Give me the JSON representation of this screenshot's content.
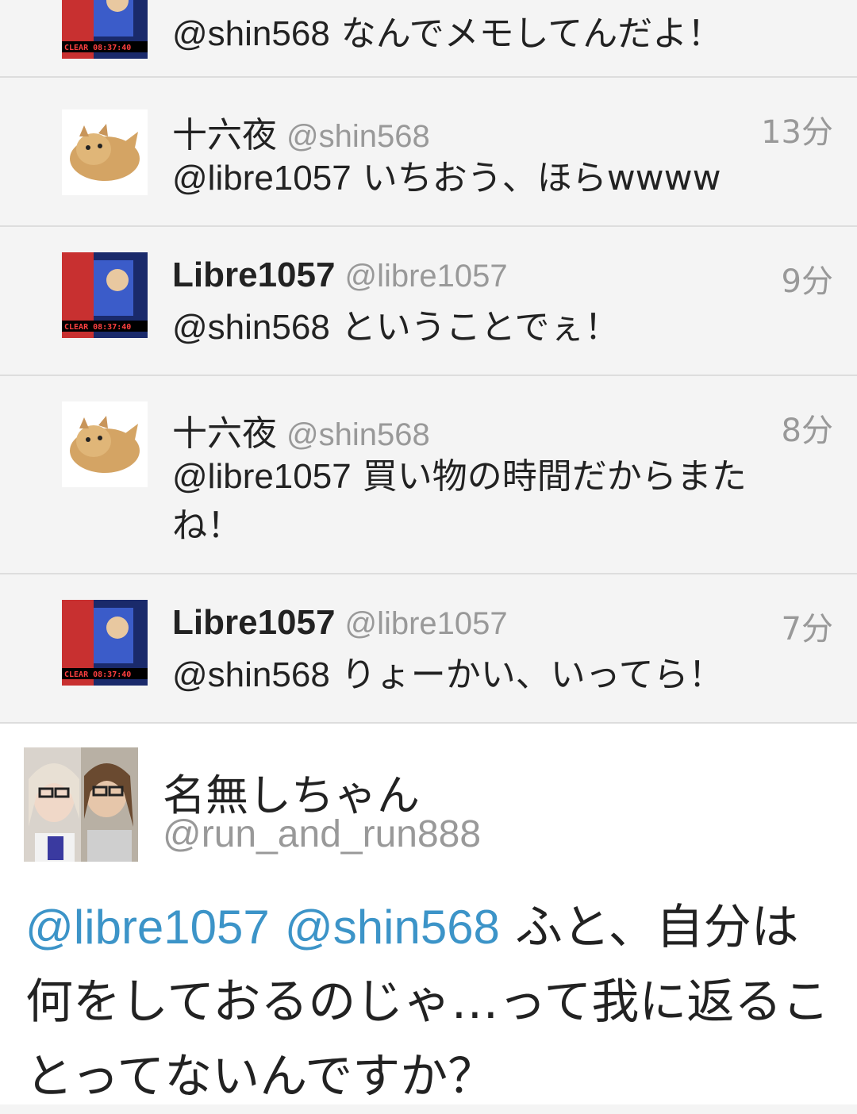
{
  "accent_color": "#2f8fd6",
  "link_color": "#3c94c8",
  "replies": [
    {
      "avatar": "game-clear-screenshot",
      "avatar_text": "CLEAR 08:37:40",
      "name": "",
      "handle": "",
      "time": "",
      "mention": "@shin568",
      "text": " なんでメモしてんだよ！"
    },
    {
      "avatar": "kitten-photo",
      "name": "十六夜",
      "handle": "@shin568",
      "time": "13分",
      "mention": "@libre1057",
      "text": " いちおう、ほらwwww"
    },
    {
      "avatar": "game-clear-screenshot",
      "avatar_text": "CLEAR 08:37:40",
      "name": "Libre1057",
      "handle": "@libre1057",
      "time": "9分",
      "mention": "@shin568",
      "text": " ということでぇ！"
    },
    {
      "avatar": "kitten-photo",
      "name": "十六夜",
      "handle": "@shin568",
      "time": "8分",
      "mention": "@libre1057",
      "text": " 買い物の時間だからまたね！"
    },
    {
      "avatar": "game-clear-screenshot",
      "avatar_text": "CLEAR 08:37:40",
      "name": "Libre1057",
      "handle": "@libre1057",
      "time": "7分",
      "mention": "@shin568",
      "text": " りょーかい、いってら！"
    }
  ],
  "detail": {
    "avatar": "two-girls-photo",
    "name": "名無しちゃん",
    "handle": "@run_and_run888",
    "mention1": "@libre1057",
    "mention2": "@shin568",
    "text": " ふと、自分は何をしておるのじゃ…って我に返ることってないんですか？"
  }
}
